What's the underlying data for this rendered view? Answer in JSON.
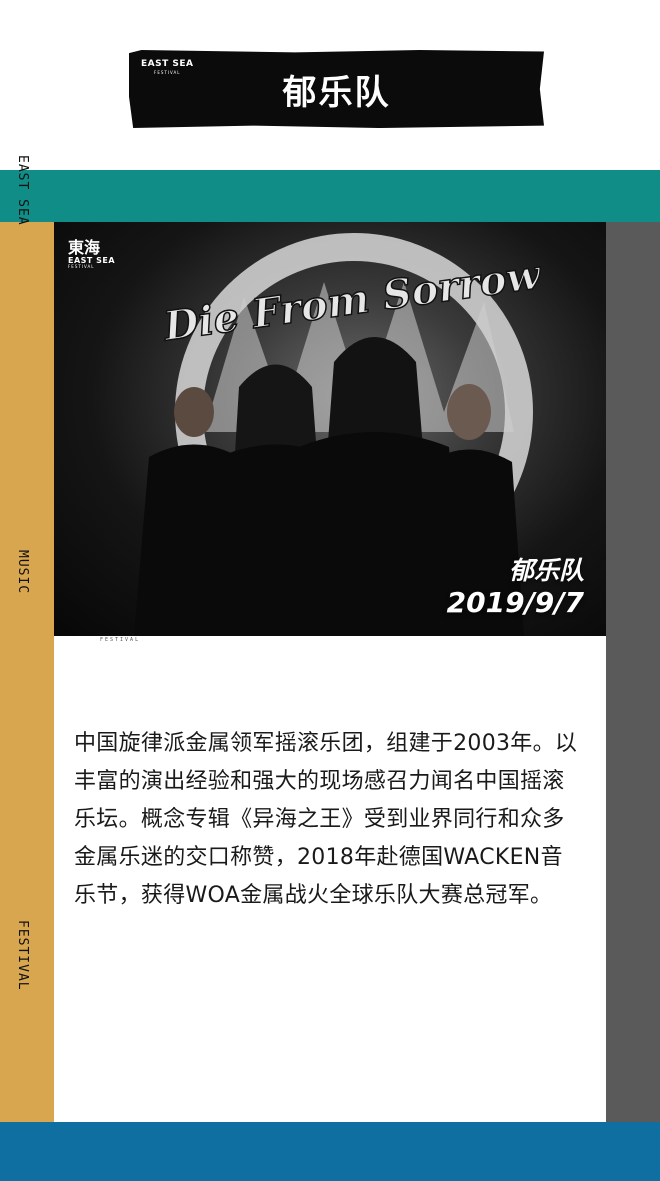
{
  "header": {
    "logo_text": "EAST SEA",
    "logo_sub": "FESTIVAL",
    "title": "郁乐队"
  },
  "side_labels": {
    "top": "EAST SEA",
    "middle": "MUSIC",
    "bottom": "FESTIVAL"
  },
  "photo": {
    "logo_cn": "東海",
    "logo_en": "EAST SEA",
    "logo_sub": "FESTIVAL",
    "band_logo_text": "Die From Sorrow",
    "caption_name": "郁乐队",
    "caption_date": "2019/9/7",
    "under_label": "FESTIVAL"
  },
  "description": "中国旋律派金属领军摇滚乐团，组建于2003年。以丰富的演出经验和强大的现场感召力闻名中国摇滚乐坛。概念专辑《异海之王》受到业界同行和众多金属乐迷的交口称赞，2018年赴德国WACKEN音乐节，获得WOA金属战火全球乐队大赛总冠军。",
  "colors": {
    "teal": "#118d88",
    "gold": "#d9a650",
    "gray": "#5a5a5a",
    "blue": "#0f6fa0",
    "plate": "#0b0b0b"
  }
}
